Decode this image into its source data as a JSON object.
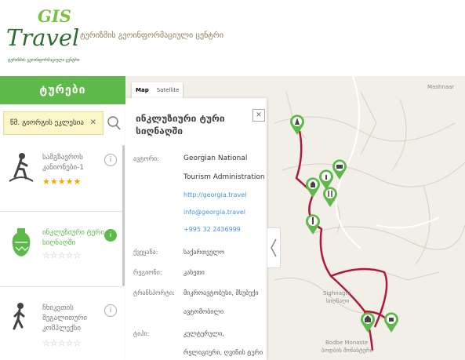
{
  "header": {
    "logo_gis": "GIS",
    "logo_travel": "Travel",
    "logo_subtitle": "ტურიზმის გეოინფორმაციული ცენტრი",
    "title": "ტურიზმის გეოინფორმაციული ცენტრი"
  },
  "sidebar": {
    "heading": "ტურები",
    "search": {
      "value": "წმ. გიორგის ეკლესია",
      "clear": "✕"
    },
    "tours": [
      {
        "title": "სამგზავროს კანიონები-1",
        "stars": "★★★★★",
        "rating": 5,
        "info": "i"
      },
      {
        "title": "ინკლუზიური ტური სიღნაღში",
        "stars": "☆☆☆☆☆",
        "rating": 0,
        "info": "i"
      },
      {
        "title": "ჩხიკვთის მეგალითური კომპლექსი",
        "stars": "☆☆☆☆☆",
        "rating": 0,
        "info": "i"
      }
    ]
  },
  "map": {
    "type_map": "Map",
    "type_satellite": "Satellite",
    "labels": {
      "mashnaari": "Mashnaar",
      "sighnaghi": "Sighnaghi",
      "sighnaghi_ka": "სიღნაღი",
      "bodbe": "Bodbe Monaste",
      "bodbe_ka": "ბოდბის მონასტერი"
    }
  },
  "panel": {
    "title": "ინკლუზიური ტური სიღნაღში",
    "close": "✕",
    "author_label": "ავტორი:",
    "author_value": "Georgian National",
    "author_value2": "Tourism Administration",
    "website": "http://georgia.travel",
    "email": "info@georgia.travel",
    "phone": "+995 32 2436999",
    "country_label": "ქვეყანა:",
    "country_value": "საქართველო",
    "region_label": "რეგიონი:",
    "region_value": "კახეთი",
    "transport_label": "ტრანსპორტი:",
    "transport_value": "მიკროავტობუსი, მსუბუქი",
    "transport_value2": "ავტომობილი",
    "type_label": "ტიპი:",
    "type_value": "კულტურული,",
    "type_value2": "რელიგიური, ღვინის ტური"
  },
  "colors": {
    "accent": "#5fb84a",
    "route": "#b0173a",
    "logo_dark": "#2f6b33"
  }
}
